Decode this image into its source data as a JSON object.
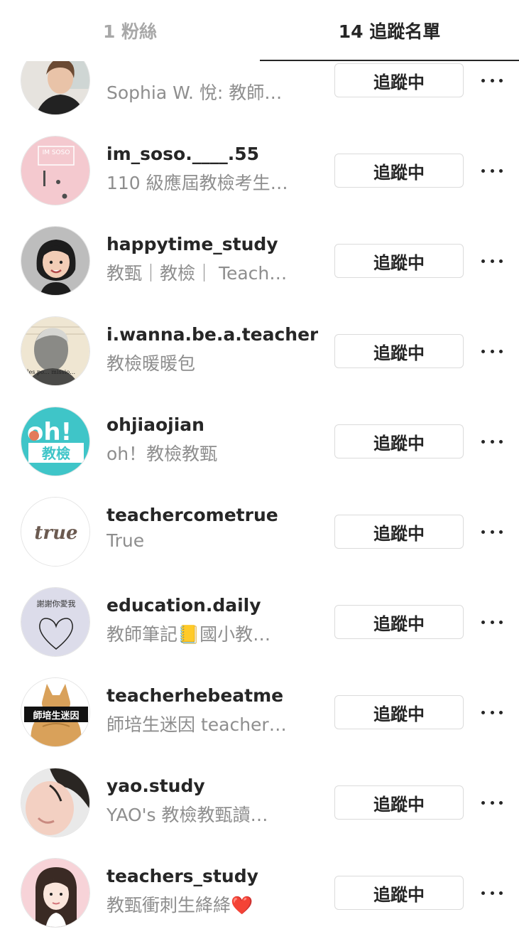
{
  "tabs": {
    "followers": "1 粉絲",
    "following": "14 追蹤名單"
  },
  "colors": {
    "primary_text": "#262626",
    "secondary_text": "#8e8e8e",
    "inactive_tab": "#a8a8a8",
    "button_border": "#dbdbdb"
  },
  "following": [
    {
      "username": "",
      "full_name": "Sophia W. 悅: 教師…",
      "button": "追蹤中",
      "avatar": "photo-woman-icon"
    },
    {
      "username": "im_soso.____.55",
      "full_name": "110 級應屆教檢考生…",
      "button": "追蹤中",
      "avatar": "imsoso-logo-icon"
    },
    {
      "username": "happytime_study",
      "full_name": "教甄｜教檢｜ Teach…",
      "button": "追蹤中",
      "avatar": "memoji-girl-icon"
    },
    {
      "username": "i.wanna.be.a.teacher",
      "full_name": "教檢暖暖包",
      "button": "追蹤中",
      "avatar": "vintage-portrait-icon"
    },
    {
      "username": "ohjiaojian",
      "full_name": "oh！教檢教甄",
      "button": "追蹤中",
      "avatar": "oh-logo-icon"
    },
    {
      "username": "teachercometrue",
      "full_name": "True",
      "button": "追蹤中",
      "avatar": "true-logo-icon"
    },
    {
      "username": "education.daily",
      "full_name": "教師筆記📒國小教…",
      "button": "追蹤中",
      "avatar": "heart-sketch-icon"
    },
    {
      "username": "teacherhebeatme",
      "full_name": "師培生迷因 teacher…",
      "button": "追蹤中",
      "avatar": "doge-meme-icon"
    },
    {
      "username": "yao.study",
      "full_name": "YAO's 教檢教甄讀…",
      "button": "追蹤中",
      "avatar": "selfie-photo-icon"
    },
    {
      "username": "teachers_study",
      "full_name": "教甄衝刺生絳絳❤️",
      "button": "追蹤中",
      "avatar": "cartoon-girl-icon"
    }
  ],
  "avatar_texts": {
    "imsoso": "IM SOSO",
    "oh": "oh!",
    "oh_sub": "教檢",
    "true": "true",
    "doge": "師培生迷因",
    "sketch": "謝謝你愛我",
    "vintage": "les po… missio…"
  }
}
